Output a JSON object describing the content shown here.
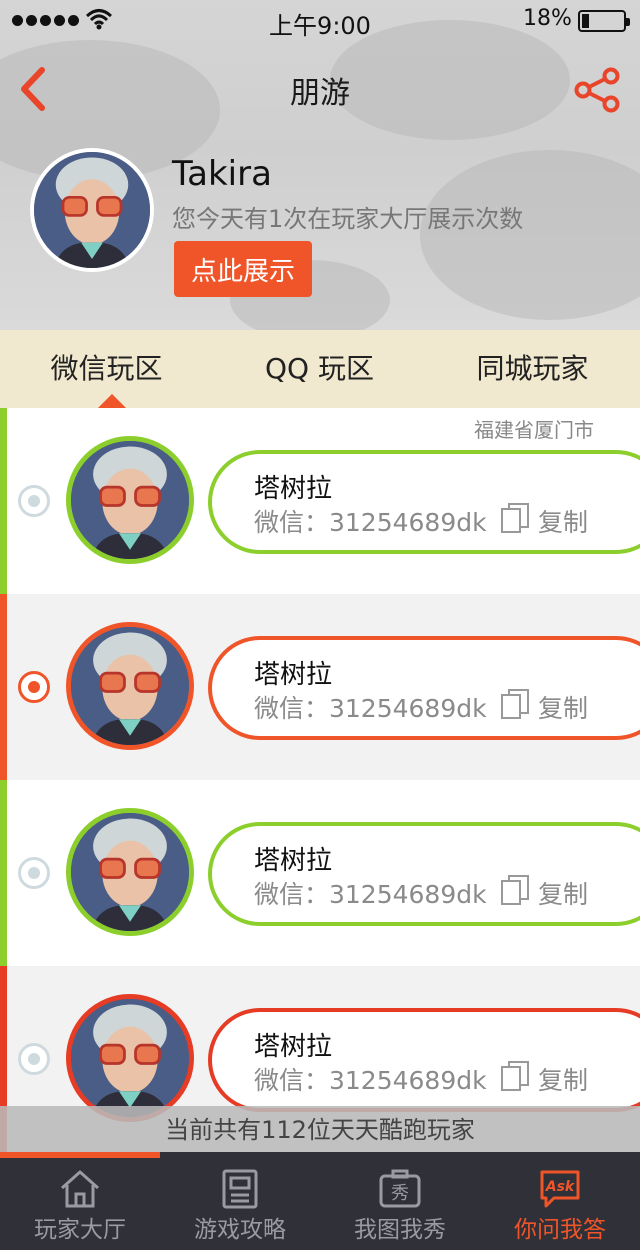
{
  "status_bar": {
    "time": "上午9:00",
    "battery_percent": "18%",
    "battery_level": 0.18
  },
  "nav": {
    "title": "朋游"
  },
  "profile": {
    "name": "Takira",
    "subtitle": "您今天有1次在玩家大厅展示次数",
    "show_button": "点此展示"
  },
  "tabs": [
    {
      "label": "微信玩区",
      "active": true
    },
    {
      "label": "QQ 玩区",
      "active": false
    },
    {
      "label": "同城玩家",
      "active": false
    }
  ],
  "location": "福建省厦门市",
  "players": [
    {
      "name": "塔树拉",
      "wechat": "微信：31254689dk",
      "copy_label": "复制",
      "accent": "#8ccf2d",
      "selected": false
    },
    {
      "name": "塔树拉",
      "wechat": "微信：31254689dk",
      "copy_label": "复制",
      "accent": "#f0552a",
      "selected": true
    },
    {
      "name": "塔树拉",
      "wechat": "微信：31254689dk",
      "copy_label": "复制",
      "accent": "#8ccf2d",
      "selected": false
    },
    {
      "name": "塔树拉",
      "wechat": "微信：31254689dk",
      "copy_label": "复制",
      "accent": "#e63b24",
      "selected": false
    }
  ],
  "count_text": "当前共有112位天天酷跑玩家",
  "progress_fraction": 0.25,
  "bottom_tabs": [
    {
      "label": "玩家大厅",
      "icon": "home-icon",
      "active": false
    },
    {
      "label": "游戏攻略",
      "icon": "guide-icon",
      "active": false
    },
    {
      "label": "我图我秀",
      "icon": "camera-icon",
      "active": false
    },
    {
      "label": "你问我答",
      "icon": "ask-icon",
      "active": true
    }
  ],
  "colors": {
    "accent": "#f0552a",
    "green": "#8ccf2d",
    "tab_bg": "#f0e9cf",
    "bar_bg": "#2f3038"
  }
}
